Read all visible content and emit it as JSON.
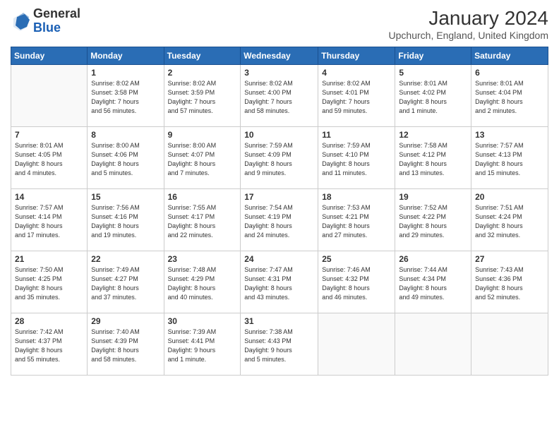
{
  "header": {
    "logo_general": "General",
    "logo_blue": "Blue",
    "month_title": "January 2024",
    "location": "Upchurch, England, United Kingdom"
  },
  "days_of_week": [
    "Sunday",
    "Monday",
    "Tuesday",
    "Wednesday",
    "Thursday",
    "Friday",
    "Saturday"
  ],
  "weeks": [
    [
      {
        "day": "",
        "info": ""
      },
      {
        "day": "1",
        "info": "Sunrise: 8:02 AM\nSunset: 3:58 PM\nDaylight: 7 hours\nand 56 minutes."
      },
      {
        "day": "2",
        "info": "Sunrise: 8:02 AM\nSunset: 3:59 PM\nDaylight: 7 hours\nand 57 minutes."
      },
      {
        "day": "3",
        "info": "Sunrise: 8:02 AM\nSunset: 4:00 PM\nDaylight: 7 hours\nand 58 minutes."
      },
      {
        "day": "4",
        "info": "Sunrise: 8:02 AM\nSunset: 4:01 PM\nDaylight: 7 hours\nand 59 minutes."
      },
      {
        "day": "5",
        "info": "Sunrise: 8:01 AM\nSunset: 4:02 PM\nDaylight: 8 hours\nand 1 minute."
      },
      {
        "day": "6",
        "info": "Sunrise: 8:01 AM\nSunset: 4:04 PM\nDaylight: 8 hours\nand 2 minutes."
      }
    ],
    [
      {
        "day": "7",
        "info": "Sunrise: 8:01 AM\nSunset: 4:05 PM\nDaylight: 8 hours\nand 4 minutes."
      },
      {
        "day": "8",
        "info": "Sunrise: 8:00 AM\nSunset: 4:06 PM\nDaylight: 8 hours\nand 5 minutes."
      },
      {
        "day": "9",
        "info": "Sunrise: 8:00 AM\nSunset: 4:07 PM\nDaylight: 8 hours\nand 7 minutes."
      },
      {
        "day": "10",
        "info": "Sunrise: 7:59 AM\nSunset: 4:09 PM\nDaylight: 8 hours\nand 9 minutes."
      },
      {
        "day": "11",
        "info": "Sunrise: 7:59 AM\nSunset: 4:10 PM\nDaylight: 8 hours\nand 11 minutes."
      },
      {
        "day": "12",
        "info": "Sunrise: 7:58 AM\nSunset: 4:12 PM\nDaylight: 8 hours\nand 13 minutes."
      },
      {
        "day": "13",
        "info": "Sunrise: 7:57 AM\nSunset: 4:13 PM\nDaylight: 8 hours\nand 15 minutes."
      }
    ],
    [
      {
        "day": "14",
        "info": "Sunrise: 7:57 AM\nSunset: 4:14 PM\nDaylight: 8 hours\nand 17 minutes."
      },
      {
        "day": "15",
        "info": "Sunrise: 7:56 AM\nSunset: 4:16 PM\nDaylight: 8 hours\nand 19 minutes."
      },
      {
        "day": "16",
        "info": "Sunrise: 7:55 AM\nSunset: 4:17 PM\nDaylight: 8 hours\nand 22 minutes."
      },
      {
        "day": "17",
        "info": "Sunrise: 7:54 AM\nSunset: 4:19 PM\nDaylight: 8 hours\nand 24 minutes."
      },
      {
        "day": "18",
        "info": "Sunrise: 7:53 AM\nSunset: 4:21 PM\nDaylight: 8 hours\nand 27 minutes."
      },
      {
        "day": "19",
        "info": "Sunrise: 7:52 AM\nSunset: 4:22 PM\nDaylight: 8 hours\nand 29 minutes."
      },
      {
        "day": "20",
        "info": "Sunrise: 7:51 AM\nSunset: 4:24 PM\nDaylight: 8 hours\nand 32 minutes."
      }
    ],
    [
      {
        "day": "21",
        "info": "Sunrise: 7:50 AM\nSunset: 4:25 PM\nDaylight: 8 hours\nand 35 minutes."
      },
      {
        "day": "22",
        "info": "Sunrise: 7:49 AM\nSunset: 4:27 PM\nDaylight: 8 hours\nand 37 minutes."
      },
      {
        "day": "23",
        "info": "Sunrise: 7:48 AM\nSunset: 4:29 PM\nDaylight: 8 hours\nand 40 minutes."
      },
      {
        "day": "24",
        "info": "Sunrise: 7:47 AM\nSunset: 4:31 PM\nDaylight: 8 hours\nand 43 minutes."
      },
      {
        "day": "25",
        "info": "Sunrise: 7:46 AM\nSunset: 4:32 PM\nDaylight: 8 hours\nand 46 minutes."
      },
      {
        "day": "26",
        "info": "Sunrise: 7:44 AM\nSunset: 4:34 PM\nDaylight: 8 hours\nand 49 minutes."
      },
      {
        "day": "27",
        "info": "Sunrise: 7:43 AM\nSunset: 4:36 PM\nDaylight: 8 hours\nand 52 minutes."
      }
    ],
    [
      {
        "day": "28",
        "info": "Sunrise: 7:42 AM\nSunset: 4:37 PM\nDaylight: 8 hours\nand 55 minutes."
      },
      {
        "day": "29",
        "info": "Sunrise: 7:40 AM\nSunset: 4:39 PM\nDaylight: 8 hours\nand 58 minutes."
      },
      {
        "day": "30",
        "info": "Sunrise: 7:39 AM\nSunset: 4:41 PM\nDaylight: 9 hours\nand 1 minute."
      },
      {
        "day": "31",
        "info": "Sunrise: 7:38 AM\nSunset: 4:43 PM\nDaylight: 9 hours\nand 5 minutes."
      },
      {
        "day": "",
        "info": ""
      },
      {
        "day": "",
        "info": ""
      },
      {
        "day": "",
        "info": ""
      }
    ]
  ]
}
